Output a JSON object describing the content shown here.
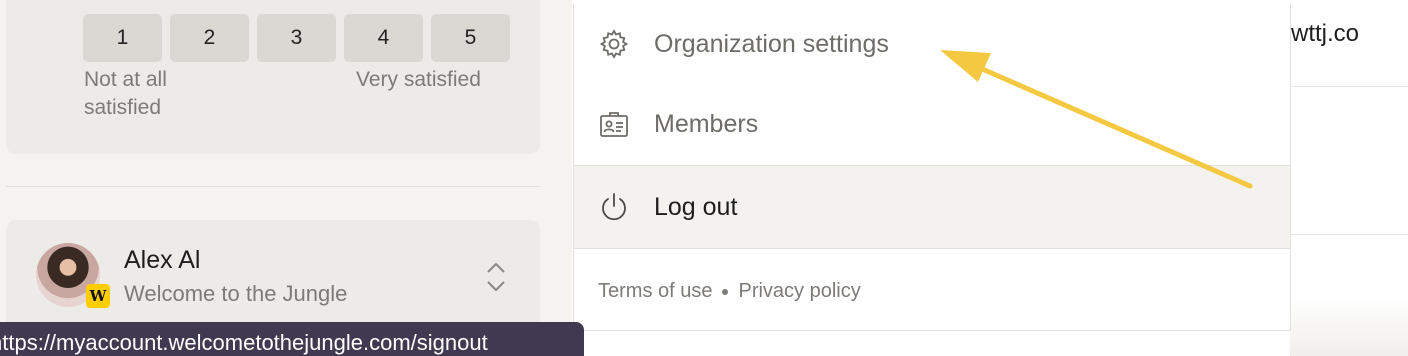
{
  "rating": {
    "options": [
      "1",
      "2",
      "3",
      "4",
      "5"
    ],
    "low_label": "Not at all satisfied",
    "high_label": "Very satisfied"
  },
  "account": {
    "name": "Alex Al",
    "organization": "Welcome to the Jungle",
    "badge": "W"
  },
  "menu": {
    "org_settings": "Organization settings",
    "members": "Members",
    "logout": "Log out",
    "terms": "Terms of use",
    "privacy": "Privacy policy"
  },
  "right": {
    "domain": "wttj.co"
  },
  "status_url": "https://myaccount.welcometothejungle.com/signout",
  "colors": {
    "arrow": "#f5c842",
    "status_bar": "#3f3a4f",
    "badge": "#ffcd00"
  },
  "icons": {
    "org_settings": "gear-icon",
    "members": "id-card-icon",
    "logout": "power-icon",
    "switch": "chevron-up-down-icon"
  }
}
